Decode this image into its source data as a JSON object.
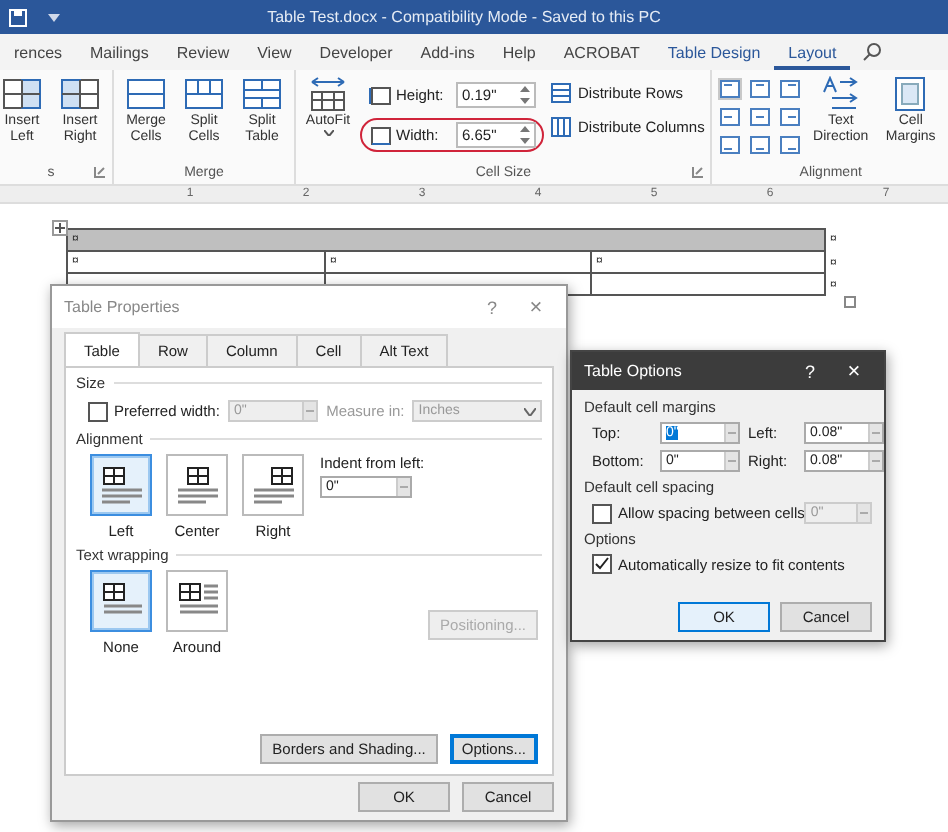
{
  "window": {
    "title": "Table Test.docx  -  Compatibility Mode  -  Saved to this PC"
  },
  "ribbon_tabs": [
    {
      "label": "rences",
      "selected": false
    },
    {
      "label": "Mailings",
      "selected": false
    },
    {
      "label": "Review",
      "selected": false
    },
    {
      "label": "View",
      "selected": false
    },
    {
      "label": "Developer",
      "selected": false
    },
    {
      "label": "Add-ins",
      "selected": false
    },
    {
      "label": "Help",
      "selected": false
    },
    {
      "label": "ACROBAT",
      "selected": false
    },
    {
      "label": "Table Design",
      "selected": false
    },
    {
      "label": "Layout",
      "selected": true
    }
  ],
  "ribbon": {
    "rows_columns": {
      "label": "s",
      "buttons": [
        {
          "label": "Insert Left"
        },
        {
          "label": "Insert Right"
        }
      ]
    },
    "merge": {
      "label": "Merge",
      "buttons": [
        {
          "label": "Merge Cells"
        },
        {
          "label": "Split Cells"
        },
        {
          "label": "Split Table"
        }
      ]
    },
    "cell_size": {
      "label": "Cell Size",
      "autofit": {
        "label": "AutoFit"
      },
      "spinners": [
        {
          "label": "Height:",
          "value": "0.19\"",
          "highlighted": false
        },
        {
          "label": "Width:",
          "value": "6.65\"",
          "highlighted": true
        }
      ],
      "distribute": [
        {
          "label": "Distribute Rows"
        },
        {
          "label": "Distribute Columns"
        }
      ]
    },
    "alignment": {
      "label": "Alignment",
      "grid": [
        {
          "selected": true
        },
        {
          "selected": false
        },
        {
          "selected": false
        },
        {
          "selected": false
        },
        {
          "selected": false
        },
        {
          "selected": false
        },
        {
          "selected": false
        },
        {
          "selected": false
        },
        {
          "selected": false
        }
      ],
      "buttons": [
        {
          "label": "Text Direction"
        },
        {
          "label": "Cell Margins"
        }
      ]
    }
  },
  "ruler": {
    "labels": [
      "1",
      "2",
      "3",
      "4",
      "5",
      "6",
      "7"
    ]
  },
  "document_table": {
    "rows": [
      {
        "shaded": true,
        "cells": [
          "¤"
        ],
        "end_mark": "¤"
      },
      {
        "shaded": false,
        "cells": [
          "¤",
          "¤",
          "¤"
        ],
        "end_mark": "¤"
      },
      {
        "shaded": false,
        "cells": [
          "",
          "",
          ""
        ],
        "end_mark": "¤"
      }
    ]
  },
  "table_properties": {
    "title": "Table Properties",
    "help": "?",
    "close": "×",
    "tabs": [
      {
        "label": "Table",
        "selected": true
      },
      {
        "label": "Row",
        "selected": false
      },
      {
        "label": "Column",
        "selected": false
      },
      {
        "label": "Cell",
        "selected": false
      },
      {
        "label": "Alt Text",
        "selected": false
      }
    ],
    "size": {
      "heading": "Size",
      "preferred_width": {
        "label": "Preferred width:",
        "checked": false
      },
      "width_value": "0\"",
      "measure_label": "Measure in:",
      "measure_value": "Inches"
    },
    "alignment": {
      "heading": "Alignment",
      "options": [
        {
          "label": "Left",
          "selected": true
        },
        {
          "label": "Center",
          "selected": false
        },
        {
          "label": "Right",
          "selected": false
        }
      ],
      "indent_label": "Indent from left:",
      "indent_value": "0\""
    },
    "text_wrapping": {
      "heading": "Text wrapping",
      "options": [
        {
          "label": "None",
          "selected": true
        },
        {
          "label": "Around",
          "selected": false
        }
      ]
    },
    "positioning": {
      "label": "Positioning...",
      "disabled": true
    },
    "buttons": [
      {
        "label": "Borders and Shading...",
        "focused": false
      },
      {
        "label": "Options...",
        "focused": true
      }
    ],
    "footer": [
      {
        "label": "OK"
      },
      {
        "label": "Cancel"
      }
    ]
  },
  "table_options": {
    "title": "Table Options",
    "help": "?",
    "close": "×",
    "margins_heading": "Default cell margins",
    "margins": [
      {
        "label": "Top:",
        "value": "0\""
      },
      {
        "label": "Left:",
        "value": "0.08\""
      },
      {
        "label": "Bottom:",
        "value": "0\""
      },
      {
        "label": "Right:",
        "value": "0.08\""
      }
    ],
    "spacing_heading": "Default cell spacing",
    "allow_spacing": {
      "label": "Allow spacing between cells",
      "checked": false
    },
    "spacing_value": "0\"",
    "options_heading": "Options",
    "auto_resize": {
      "label": "Automatically resize to fit contents",
      "checked": true
    },
    "footer": [
      {
        "label": "OK",
        "default": true
      },
      {
        "label": "Cancel",
        "default": false
      }
    ]
  }
}
